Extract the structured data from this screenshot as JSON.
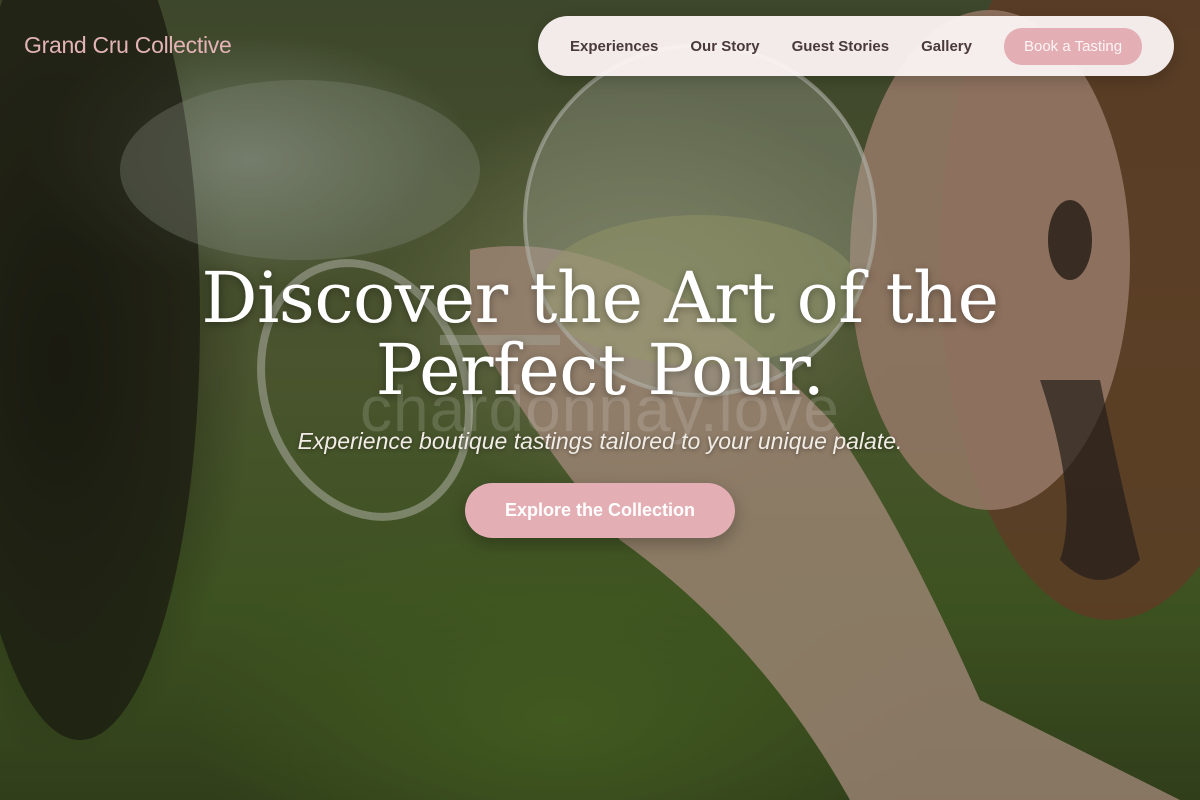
{
  "brand": {
    "name": "Grand Cru Collective",
    "color": "#e3b3b6"
  },
  "nav": {
    "items": [
      {
        "label": "Experiences"
      },
      {
        "label": "Our Story"
      },
      {
        "label": "Guest Stories"
      },
      {
        "label": "Gallery"
      }
    ],
    "cta_label": "Book a Tasting"
  },
  "hero": {
    "headline_line1": "Discover the Art of the",
    "headline_line2": "Perfect Pour.",
    "subtitle": "Experience boutique tastings tailored to your unique palate.",
    "cta_label": "Explore the Collection",
    "watermark": "chardonnay.love",
    "background_description_icon": "wine-glass-photo"
  },
  "colors": {
    "accent": "#e3aeb4",
    "nav_bg": "#fcf4f4",
    "nav_text": "#4a3a3a"
  }
}
